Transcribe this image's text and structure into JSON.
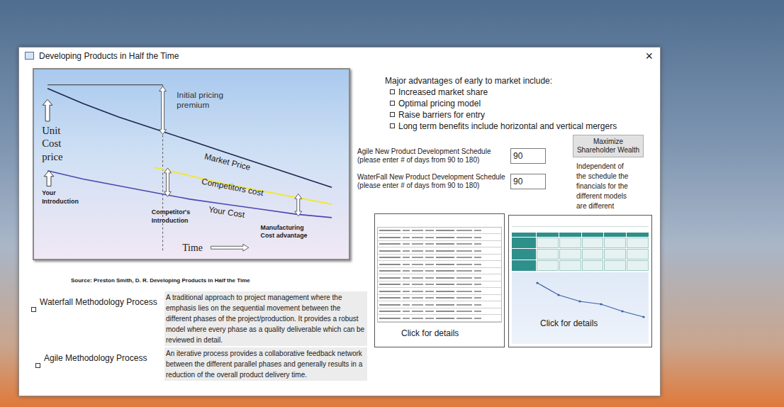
{
  "window": {
    "title": "Developing Products in Half the Time",
    "close": "×"
  },
  "diagram": {
    "pricing_premium": [
      "Initial pricing",
      "premium"
    ],
    "axis_label": [
      "Unit",
      "Cost",
      "price"
    ],
    "your_introduction": [
      "Your",
      "Introduction"
    ],
    "competitor_introduction": [
      "Competitor's",
      "Introduction"
    ],
    "cost_advantage": [
      "Manufacturing",
      "Cost advantage"
    ],
    "time": "Time",
    "series": [
      {
        "name": "Market Price",
        "color": "#1c2550",
        "start": 0,
        "values": [
          9.7,
          8.8,
          8.0,
          7.3,
          6.6,
          5.9,
          5.2,
          4.5,
          3.8
        ]
      },
      {
        "name": "Competitors cost",
        "color": "#f2e63a",
        "start": 3,
        "values": [
          5.0,
          4.5,
          4.0,
          3.6,
          3.2,
          2.8
        ]
      },
      {
        "name": "Your Cost",
        "color": "#4a48b0",
        "start": 0,
        "values": [
          4.8,
          4.3,
          3.9,
          3.5,
          3.1,
          2.8,
          2.5,
          2.2,
          2.0
        ]
      }
    ]
  },
  "source": "Source: Preston Smith, D. R. Developing Products in Half the Time",
  "methodologies": [
    {
      "label": "Waterfall Methodology Process",
      "checked": false,
      "description": "A traditional approach to project management where the emphasis lies on the sequential movement between the different phases of the project/production. It provides a robust model where every phase as a quality deliverable which can be reviewed in detail."
    },
    {
      "label": "Agile Methodology Process",
      "checked": false,
      "description": "An iterative process provides a collaborative feedback network between the different parallel phases and generally results in a reduction of the overall product delivery time."
    }
  ],
  "advantages": {
    "title": "Major advantages of early to market include:",
    "items": [
      {
        "label": "Increased market share",
        "checked": false
      },
      {
        "label": "Optimal pricing model",
        "checked": false
      },
      {
        "label": "Raise barriers for entry",
        "checked": false
      },
      {
        "label": "Long term benefits include horizontal and vertical mergers",
        "checked": false
      }
    ]
  },
  "schedules": [
    {
      "label": "Agile New Product Development Schedule",
      "hint": "(please enter # of days from 90 to 180)",
      "value": "90"
    },
    {
      "label": "WaterFall New Product Development Schedule",
      "hint": "(please enter # of days from 90 to 180)",
      "value": "90"
    }
  ],
  "action_button": "Maximize Shareholder Wealth",
  "note": "Independent of the schedule the financials for the different models are different",
  "thumbnails": [
    {
      "kind": "table",
      "caption": "Click for details"
    },
    {
      "kind": "chart",
      "caption": "Click for details",
      "values": [
        21.25,
        17,
        14.75,
        13.75,
        11.25,
        9.25
      ]
    }
  ]
}
